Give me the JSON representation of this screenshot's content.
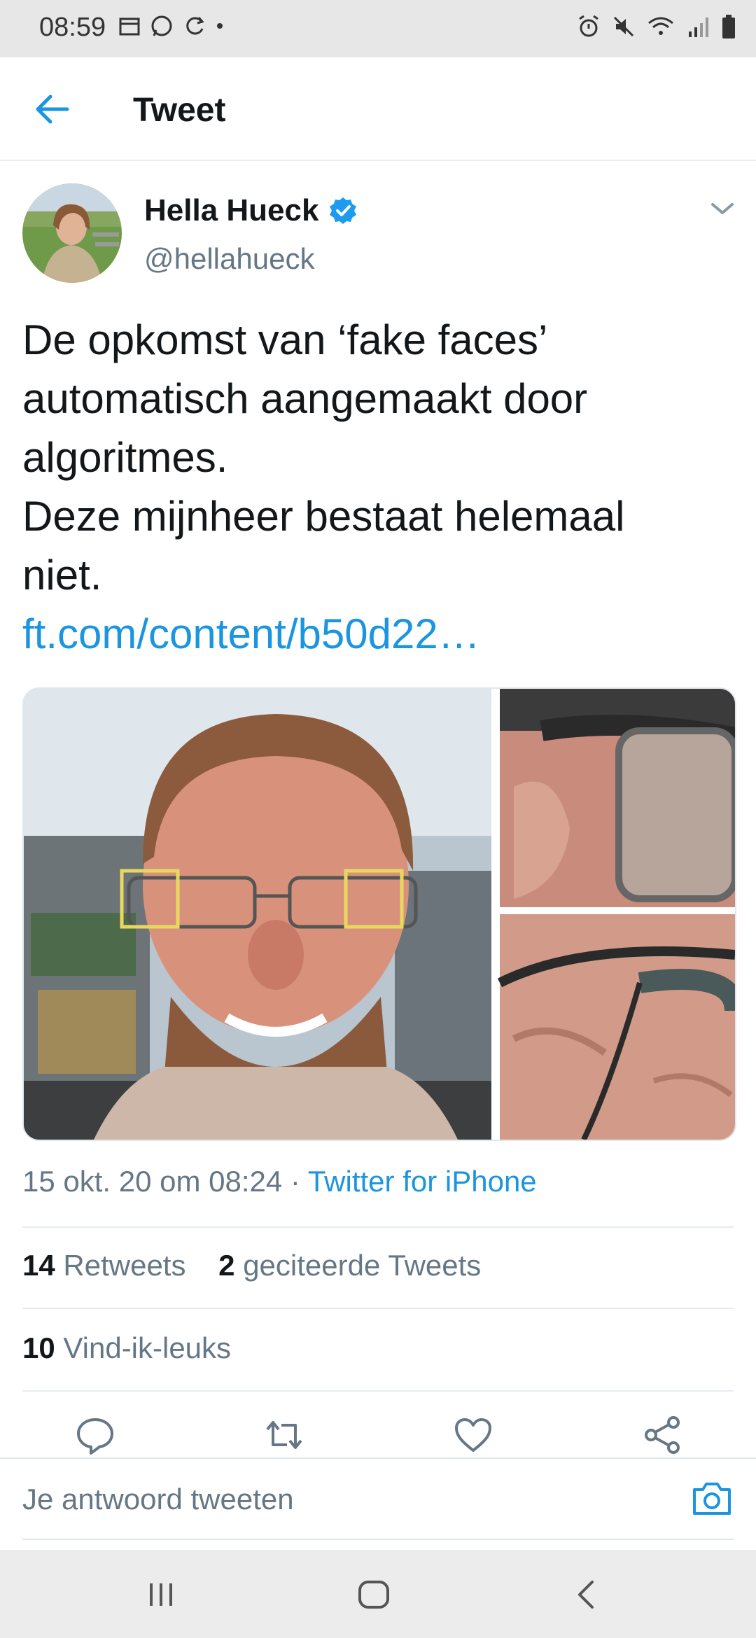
{
  "status_bar": {
    "time": "08:59"
  },
  "header": {
    "title": "Tweet"
  },
  "tweet": {
    "author_name": "Hella Hueck",
    "author_handle": "@hellahueck",
    "text_lines": [
      "De opkomst van ‘fake faces’",
      "automatisch aangemaakt door",
      "algoritmes.",
      "Deze mijnheer bestaat helemaal",
      "niet."
    ],
    "link": "ft.com/content/b50d22…",
    "timestamp": "15 okt. 20 om 08:24",
    "separator": " · ",
    "source": "Twitter for iPhone"
  },
  "stats": {
    "retweets_count": "14",
    "retweets_label": "Retweets",
    "quotes_count": "2",
    "quotes_label": "geciteerde Tweets",
    "likes_count": "10",
    "likes_label": "Vind-ik-leuks"
  },
  "reply": {
    "placeholder": "Je antwoord tweeten"
  },
  "colors": {
    "accent": "#1b95e0",
    "muted": "#657786"
  }
}
